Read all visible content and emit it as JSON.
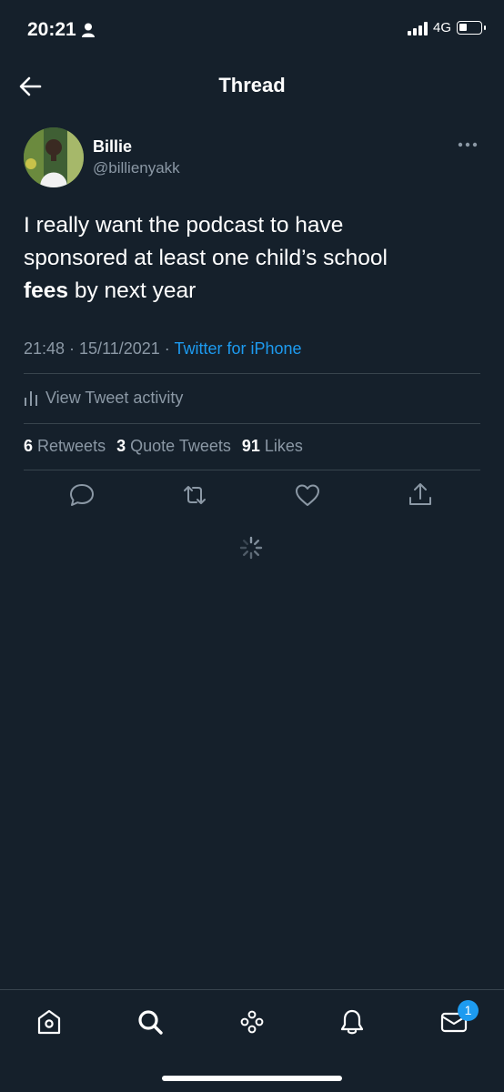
{
  "status_bar": {
    "time": "20:21",
    "network": "4G"
  },
  "header": {
    "title": "Thread"
  },
  "tweet": {
    "author": {
      "name": "Billie",
      "handle": "@billienyakk"
    },
    "text_line1": "I really want the podcast to have",
    "text_line2": "sponsored at least one child’s school",
    "text_bold": "fees",
    "text_rest": " by next year",
    "timestamp": "21:48 · 15/11/2021 · ",
    "source": "Twitter for iPhone",
    "activity_label": "View Tweet activity",
    "stats": {
      "retweets_count": "6",
      "retweets_label": "Retweets",
      "quotes_count": "3",
      "quotes_label": "Quote Tweets",
      "likes_count": "91",
      "likes_label": "Likes"
    }
  },
  "bottom_nav": {
    "messages_badge": "1"
  },
  "colors": {
    "background": "#15202b",
    "accent": "#1d9bf0",
    "secondary_text": "#8b98a5",
    "divider": "#38444d"
  },
  "icons": [
    "back-arrow-icon",
    "more-icon",
    "activity-icon",
    "reply-icon",
    "retweet-icon",
    "like-icon",
    "share-icon",
    "loading-spinner-icon",
    "home-icon",
    "search-icon",
    "spaces-icon",
    "notifications-icon",
    "messages-icon"
  ]
}
